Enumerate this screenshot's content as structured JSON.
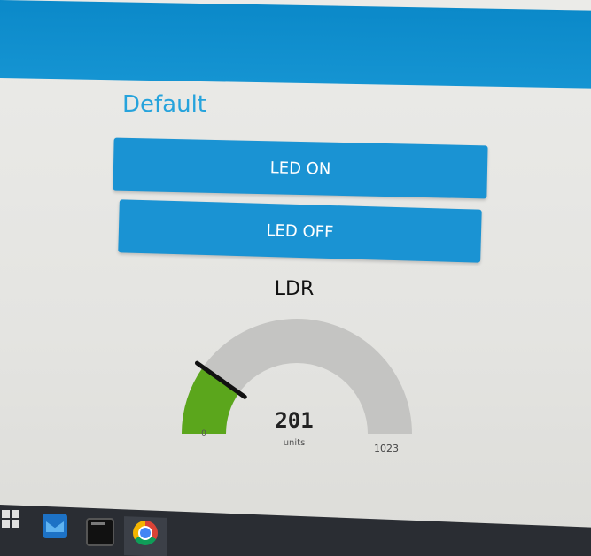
{
  "group": {
    "title": "Default"
  },
  "buttons": {
    "led_on": "LED ON",
    "led_off": "LED OFF"
  },
  "gauge": {
    "title": "LDR",
    "value": 201,
    "value_text": "201",
    "units": "units",
    "min": 0,
    "max": 1023,
    "min_text": "0",
    "max_text": "1023",
    "fill_color": "#5ba61c",
    "track_color": "#c4c4c2",
    "needle_color": "#111111"
  },
  "colors": {
    "header": "#0b89c9",
    "accent": "#1a93d3",
    "title": "#26a3dc"
  },
  "taskbar": {
    "icons": [
      "windows-start-icon",
      "mail-icon",
      "terminal-icon",
      "chrome-icon"
    ]
  }
}
